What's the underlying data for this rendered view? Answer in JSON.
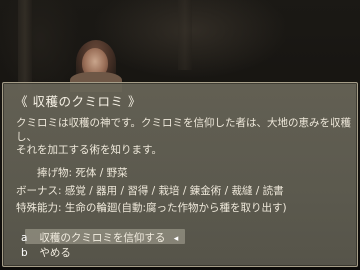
{
  "dialog": {
    "title": "《 収穫のクミロミ 》",
    "description_line1": "クミロミは収穫の神です。クミロミを信仰した者は、大地の恵みを収穫し、",
    "description_line2": "それを加工する術を知ります。",
    "offerings_label": "捧げ物:",
    "offerings_value": "死体 / 野菜",
    "bonus_label": "ボーナス:",
    "bonus_value": "感覚 / 器用 / 習得 / 栽培 / 錬金術 / 裁縫 / 読書",
    "ability_label": "特殊能力:",
    "ability_value": "生命の輪廻(自動:腐った作物から種を取り出す)"
  },
  "options": [
    {
      "key": "a",
      "label": "収穫のクミロミを信仰する",
      "selected": true
    },
    {
      "key": "b",
      "label": "やめる",
      "selected": false
    }
  ],
  "cursor_glyph": "◂",
  "colors": {
    "panel_bg": "#615e53",
    "panel_border": "#a59d88",
    "text": "#eee8da",
    "selection": "#969384"
  }
}
